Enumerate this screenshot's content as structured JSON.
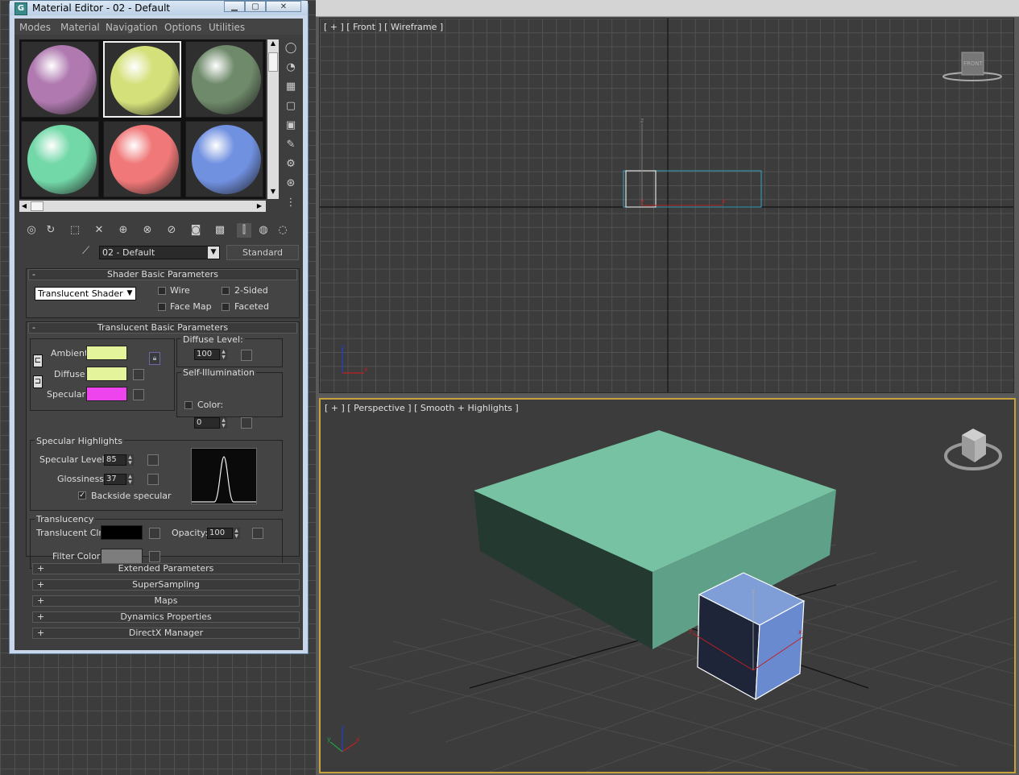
{
  "window": {
    "title": "Material Editor - 02 - Default",
    "icon_letter": "G"
  },
  "menu": [
    "Modes",
    "Material",
    "Navigation",
    "Options",
    "Utilities"
  ],
  "slots": [
    {
      "color": "#b07ab0",
      "selected": false
    },
    {
      "color": "#d4e07a",
      "selected": true
    },
    {
      "color": "#6f8a6a",
      "selected": false
    },
    {
      "color": "#72d8a8",
      "selected": false
    },
    {
      "color": "#f07878",
      "selected": false
    },
    {
      "color": "#7090e0",
      "selected": false
    }
  ],
  "material": {
    "name": "02 - Default",
    "type": "Standard"
  },
  "shader_basic": {
    "header": "Shader Basic Parameters",
    "collapse_sign": "-",
    "shader": "Translucent Shader",
    "wire": "Wire",
    "two_sided": "2-Sided",
    "face_map": "Face Map",
    "faceted": "Faceted"
  },
  "translucent_basic": {
    "header": "Translucent Basic Parameters",
    "collapse_sign": "-",
    "ambient_label": "Ambient:",
    "diffuse_label": "Diffuse:",
    "specular_label": "Specular:",
    "ambient_color": "#e4f49a",
    "diffuse_color": "#e4f49a",
    "specular_color": "#ee44ee",
    "diffuse_level_label": "Diffuse Level:",
    "diffuse_level": "100",
    "self_illum_label": "Self-Illumination",
    "color_label": "Color:",
    "self_illum_value": "0",
    "lock_icon": "lock-icon"
  },
  "specular_highlights": {
    "title": "Specular Highlights",
    "level_label": "Specular Level:",
    "level": "85",
    "gloss_label": "Glossiness:",
    "gloss": "37",
    "backside_label": "Backside specular",
    "backside_checked": "✓"
  },
  "translucency": {
    "title": "Translucency",
    "clr_label": "Translucent Clr:",
    "clr_color": "#000000",
    "opacity_label": "Opacity:",
    "opacity": "100",
    "filter_label": "Filter Color:",
    "filter_color": "#7d7d7d"
  },
  "rollouts": [
    {
      "sign": "+",
      "label": "Extended Parameters"
    },
    {
      "sign": "+",
      "label": "SuperSampling"
    },
    {
      "sign": "+",
      "label": "Maps"
    },
    {
      "sign": "+",
      "label": "Dynamics Properties"
    },
    {
      "sign": "+",
      "label": "DirectX Manager"
    }
  ],
  "viewports": {
    "front_label": "[ + ] [ Front ] [ Wireframe ]",
    "persp_label": "[ + ] [ Perspective ] [ Smooth + Highlights ]",
    "front_cube_text": "FRONT"
  },
  "colors": {
    "box_top": "#78c2a4",
    "box_front": "#5fa088",
    "box_side": "#243a30",
    "cube_top": "#7f9ed8",
    "cube_right": "#6a8ad0",
    "cube_left": "#1f2538",
    "active_border": "#c8a23c"
  }
}
